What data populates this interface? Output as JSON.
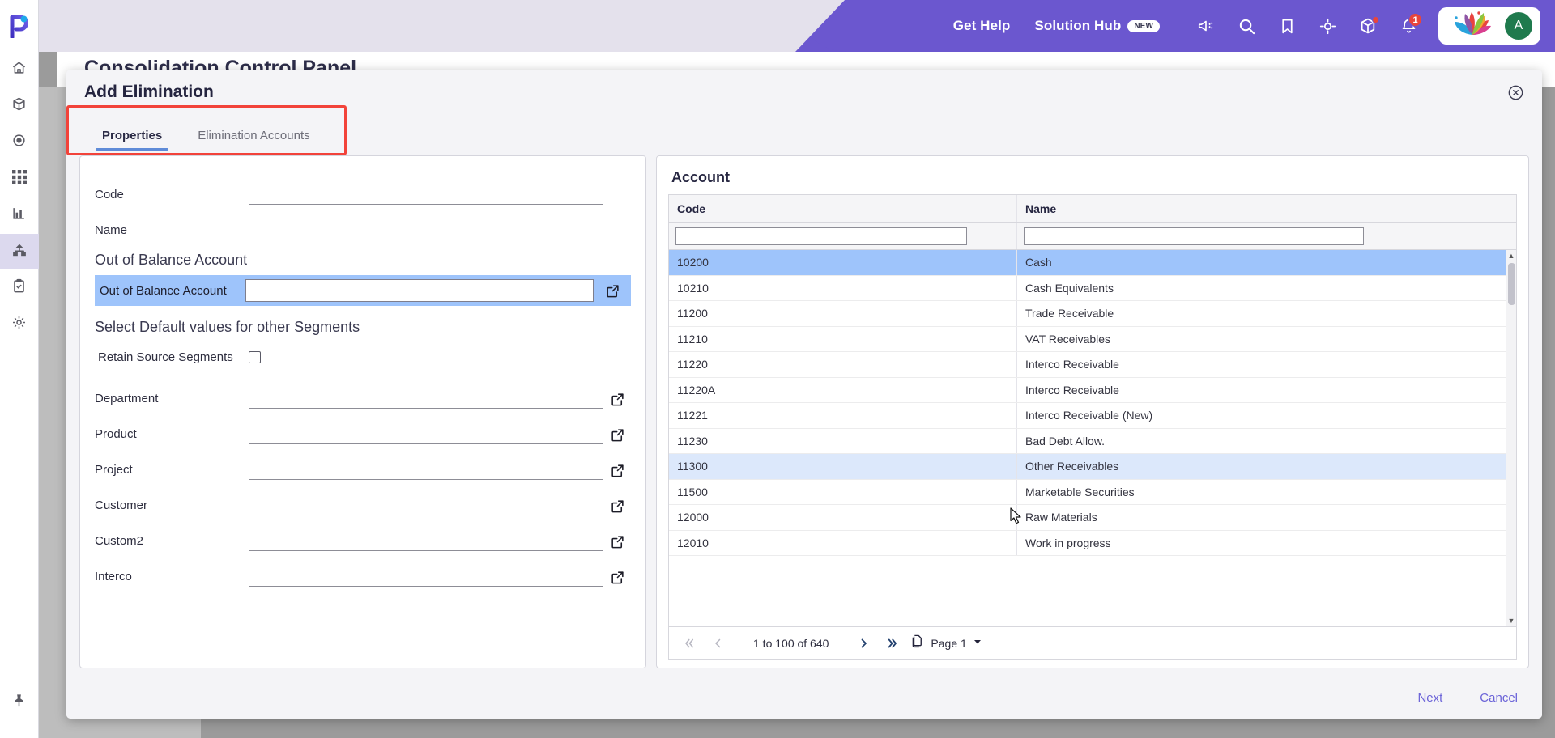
{
  "topbar": {
    "get_help_label": "Get Help",
    "solution_hub_label": "Solution Hub",
    "new_badge": "NEW",
    "notification_count": "1",
    "avatar_initial": "A",
    "icons": [
      "megaphone-icon",
      "search-icon",
      "bookmark-icon",
      "target-icon",
      "cube-icon",
      "bell-icon"
    ],
    "accent_purple": "#6b57cf"
  },
  "rail": {
    "items": [
      {
        "name": "home-icon"
      },
      {
        "name": "cube-icon"
      },
      {
        "name": "target-icon"
      },
      {
        "name": "grid-icon"
      },
      {
        "name": "chart-icon"
      },
      {
        "name": "hierarchy-icon"
      },
      {
        "name": "clipboard-check-icon"
      },
      {
        "name": "gear-icon"
      }
    ],
    "pin_icon": "pin-icon"
  },
  "page": {
    "title_behind_modal": "Consolidation Control Panel"
  },
  "modal": {
    "title": "Add Elimination",
    "close_icon": "close-icon",
    "tabs": [
      {
        "label": "Properties",
        "active": true
      },
      {
        "label": "Elimination Accounts",
        "active": false
      }
    ],
    "highlight_color": "#f2433a"
  },
  "form": {
    "fields": [
      {
        "label": "Code",
        "value": "",
        "placeholder": "",
        "has_picker": false
      },
      {
        "label": "Name",
        "value": "",
        "placeholder": "",
        "has_picker": false
      }
    ],
    "out_of_balance_heading": "Out of Balance Account",
    "out_of_balance_field": {
      "label": "Out of Balance Account",
      "value": "",
      "placeholder": "",
      "has_picker": true
    },
    "segments_heading": "Select Default values for other Segments",
    "retain_source_segments": {
      "label": "Retain Source Segments",
      "checked": false
    },
    "segment_fields": [
      {
        "label": "Department",
        "value": "",
        "has_picker": true
      },
      {
        "label": "Product",
        "value": "",
        "has_picker": true
      },
      {
        "label": "Project",
        "value": "",
        "has_picker": true
      },
      {
        "label": "Customer",
        "value": "",
        "has_picker": true
      },
      {
        "label": "Custom2",
        "value": "",
        "has_picker": true
      },
      {
        "label": "Interco",
        "value": "",
        "has_picker": true
      }
    ]
  },
  "grid": {
    "title": "Account",
    "columns": [
      {
        "key": "code",
        "label": "Code",
        "filter_value": ""
      },
      {
        "key": "name",
        "label": "Name",
        "filter_value": ""
      }
    ],
    "rows": [
      {
        "code": "10200",
        "name": "Cash",
        "state": "selected"
      },
      {
        "code": "10210",
        "name": "Cash Equivalents",
        "state": "normal"
      },
      {
        "code": "11200",
        "name": "Trade Receivable",
        "state": "normal"
      },
      {
        "code": "11210",
        "name": "VAT Receivables",
        "state": "normal"
      },
      {
        "code": "11220",
        "name": "Interco Receivable",
        "state": "normal"
      },
      {
        "code": "11220A",
        "name": "Interco Receivable",
        "state": "normal"
      },
      {
        "code": "11221",
        "name": "Interco Receivable (New)",
        "state": "normal"
      },
      {
        "code": "11230",
        "name": "Bad Debt Allow.",
        "state": "normal"
      },
      {
        "code": "11300",
        "name": "Other Receivables",
        "state": "hover"
      },
      {
        "code": "11500",
        "name": "Marketable Securities",
        "state": "normal"
      },
      {
        "code": "12000",
        "name": "Raw Materials",
        "state": "normal"
      },
      {
        "code": "12010",
        "name": "Work in progress",
        "state": "normal"
      }
    ],
    "pagination": {
      "first_icon": "first-page-icon",
      "prev_icon": "prev-page-icon",
      "range_text": "1 to 100 of 640",
      "next_icon": "next-page-icon",
      "last_icon": "last-page-icon",
      "page_icon": "pages-icon",
      "page_label": "Page 1",
      "dropdown_icon": "chevron-down-icon"
    }
  },
  "footer": {
    "next_label": "Next",
    "cancel_label": "Cancel"
  }
}
